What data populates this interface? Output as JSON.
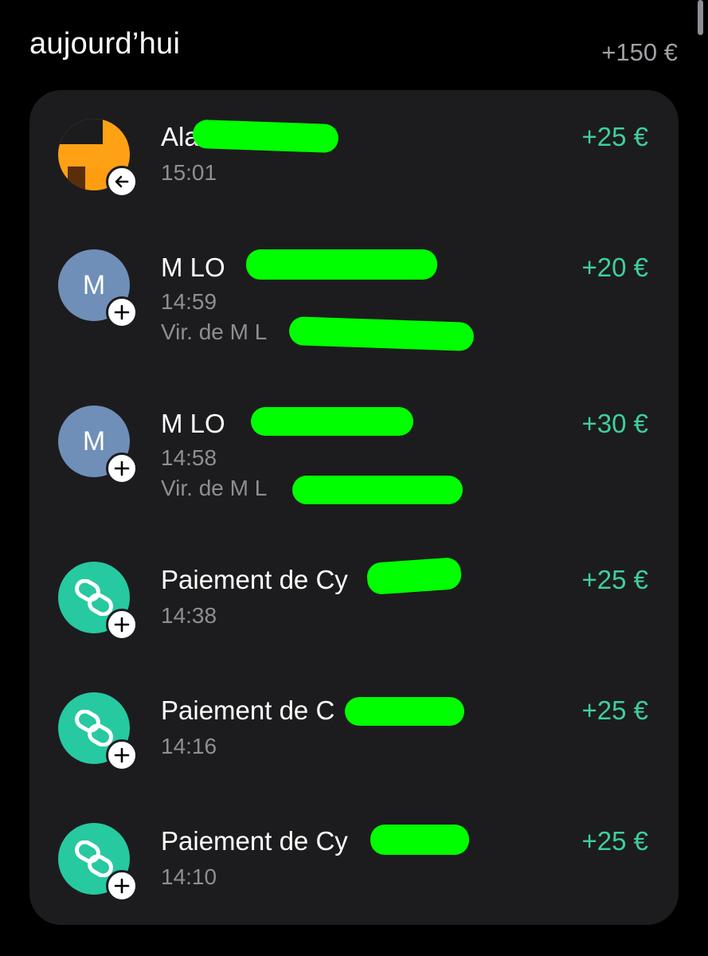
{
  "section": {
    "title": "aujourd’hui",
    "total": "+150 €"
  },
  "colors": {
    "background": "#000000",
    "card": "#1c1c1e",
    "positive_amount": "#3fcf9b",
    "secondary_text": "#8e8e93",
    "avatar_blue": "#6f8fb8",
    "avatar_teal": "#27c9a0",
    "avatar_orange": "#ffa114",
    "redaction": "#00ff00"
  },
  "transactions": [
    {
      "name": "Alai",
      "time": "15:01",
      "reference": "",
      "amount": "+25 €",
      "avatar": "photo",
      "badge_icon": "arrow-left-icon"
    },
    {
      "name": "M     LO",
      "time": "14:59",
      "reference": "Vir. de M L",
      "amount": "+20 €",
      "avatar_letter": "M",
      "badge_icon": "plus-icon"
    },
    {
      "name": "M     LO",
      "time": "14:58",
      "reference": "Vir. de M L",
      "amount": "+30 €",
      "avatar_letter": "M",
      "badge_icon": "plus-icon"
    },
    {
      "name": "Paiement de Cy",
      "time": "14:38",
      "reference": "",
      "amount": "+25 €",
      "avatar_icon": "link-icon",
      "badge_icon": "plus-icon"
    },
    {
      "name": "Paiement de C",
      "time": "14:16",
      "reference": "",
      "amount": "+25 €",
      "avatar_icon": "link-icon",
      "badge_icon": "plus-icon"
    },
    {
      "name": "Paiement de Cy",
      "time": "14:10",
      "reference": "",
      "amount": "+25 €",
      "avatar_icon": "link-icon",
      "badge_icon": "plus-icon"
    }
  ]
}
